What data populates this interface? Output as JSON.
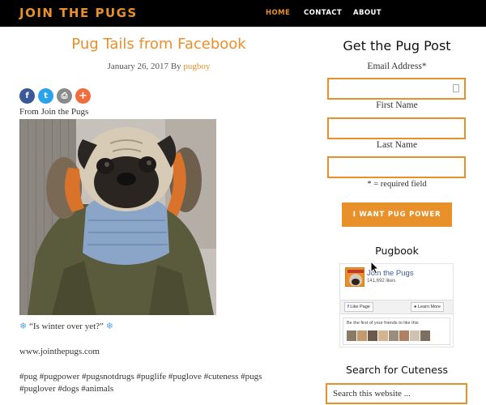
{
  "header": {
    "logo": "JOIN THE PUGS",
    "nav": [
      {
        "label": "HOME",
        "active": true
      },
      {
        "label": "CONTACT",
        "active": false
      },
      {
        "label": "ABOUT",
        "active": false
      }
    ]
  },
  "post": {
    "title": "Pug Tails from Facebook",
    "date": "January 26, 2017",
    "by": "By",
    "author": "pugboy",
    "share_icons": [
      "facebook-icon",
      "twitter-icon",
      "print-icon",
      "more-share-icon"
    ],
    "share_glyphs": {
      "facebook": "f",
      "twitter": "t",
      "print": "⎙",
      "more": "+"
    },
    "from_text": "From Join the Pugs",
    "caption_quote": "“Is winter over yet?”",
    "caption_icon": "snowflake-icon",
    "caption_glyph": "❄",
    "site": "www.jointhepugs.com",
    "tags_line1": "#pug #pugpower #pugsnotdrugs #puglife #puglove #cuteness #pugs",
    "tags_line2": "#puglover #dogs #animals"
  },
  "sidebar": {
    "newsletter_title": "Get the Pug Post",
    "email_label": "Email Address*",
    "first_name_label": "First Name",
    "last_name_label": "Last Name",
    "email_value": "",
    "first_name_value": "",
    "last_name_value": "",
    "required_note": "* = required field",
    "submit_label": "I WANT PUG POWER",
    "pugbook_title": "Pugbook",
    "fb_page_name": "Join the Pugs",
    "fb_likes": "141,692 likes",
    "fb_like_button": "Like Page",
    "fb_learn_button": "Learn More",
    "fb_friends_text": "Be the first of your friends to like this",
    "search_title": "Search for Cuteness",
    "search_placeholder": "Search this website ..."
  },
  "colors": {
    "accent": "#e8902a",
    "header_bg": "#000000",
    "facebook": "#3b5998",
    "twitter": "#2aa3ef",
    "print": "#8a8a8a",
    "more": "#f36c3d"
  }
}
